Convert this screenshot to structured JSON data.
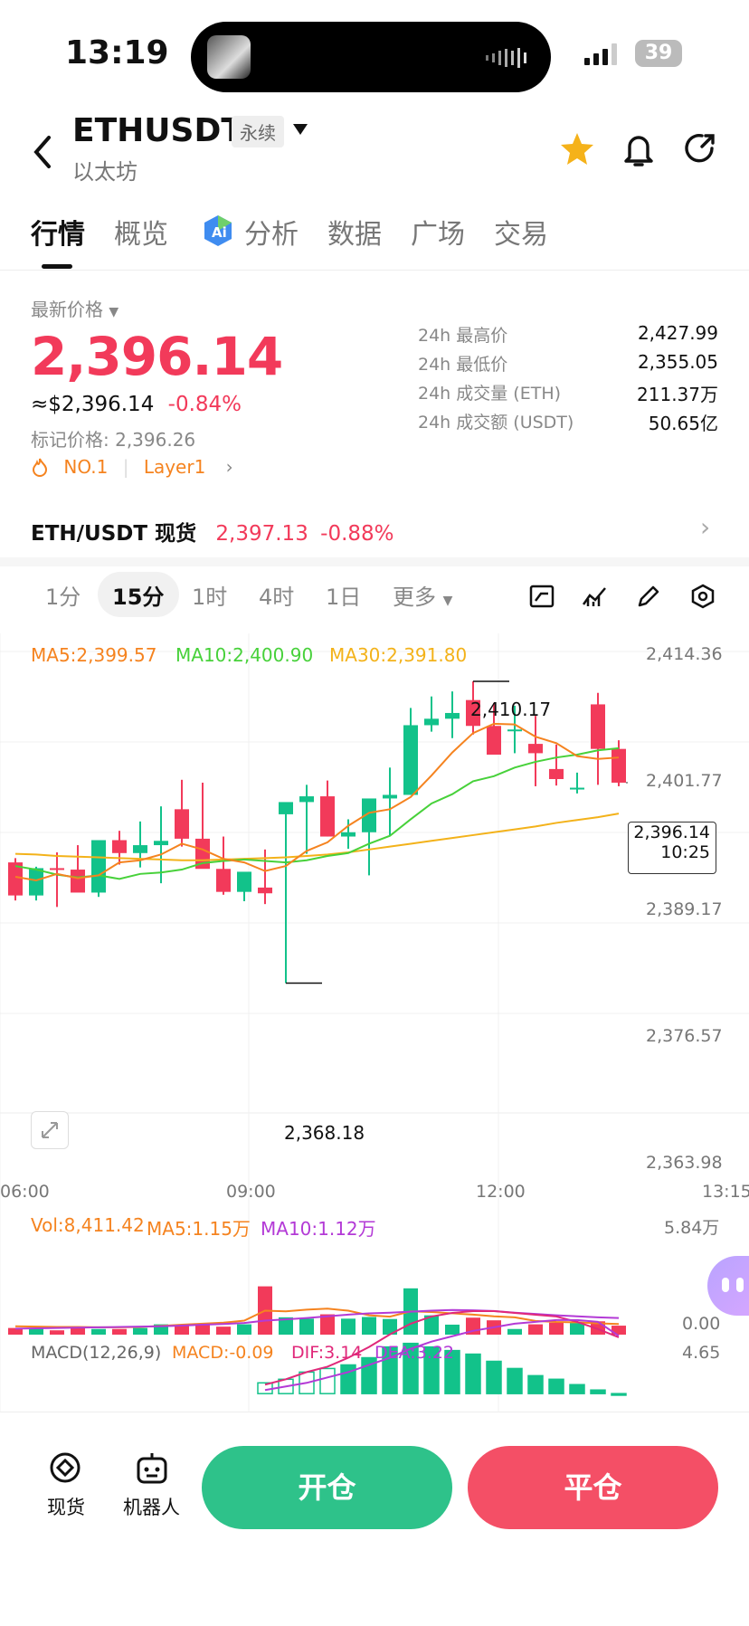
{
  "status": {
    "time": "13:19",
    "battery": "39"
  },
  "header": {
    "symbol": "ETHUSDT",
    "tag": "永续",
    "subtitle": "以太坊"
  },
  "tabs": [
    "行情",
    "概览",
    "分析",
    "数据",
    "广场",
    "交易"
  ],
  "price": {
    "label": "最新价格",
    "last": "2,396.14",
    "usd": "≈$2,396.14",
    "change": "-0.84%",
    "mark": "标记价格: 2,396.26",
    "rank": "NO.1",
    "sector": "Layer1"
  },
  "stats": [
    {
      "label": "24h 最高价",
      "value": "2,427.99"
    },
    {
      "label": "24h 最低价",
      "value": "2,355.05"
    },
    {
      "label": "24h 成交量 (ETH)",
      "value": "211.37万"
    },
    {
      "label": "24h 成交额 (USDT)",
      "value": "50.65亿"
    }
  ],
  "spot": {
    "pair": "ETH/USDT 现货",
    "price": "2,397.13",
    "change": "-0.88%"
  },
  "intervals": [
    "1分",
    "15分",
    "1时",
    "4时",
    "1日",
    "更多"
  ],
  "selected_interval": "15分",
  "ma": {
    "ma5": "MA5:2,399.57",
    "ma10": "MA10:2,400.90",
    "ma30": "MA30:2,391.80"
  },
  "y_ticks": [
    "2,414.36",
    "2,401.77",
    "2,389.17",
    "2,376.57",
    "2,363.98"
  ],
  "x_ticks": [
    "06:00",
    "09:00",
    "12:00",
    "13:15"
  ],
  "chart_annotations": {
    "high": "2,410.17",
    "low": "2,368.18",
    "current_price": "2,396.14",
    "countdown": "10:25"
  },
  "volume": {
    "vol": "Vol:8,411.42",
    "ma5": "MA5:1.15万",
    "ma10": "MA10:1.12万",
    "max": "5.84万",
    "min": "0.00"
  },
  "macd": {
    "label": "MACD(12,26,9)",
    "macd": "MACD:-0.09",
    "dif": "DIF:3.14",
    "dea": "DEA:3.22",
    "max": "4.65"
  },
  "bottom": {
    "spot_label": "现货",
    "bot_label": "机器人",
    "open_label": "开仓",
    "close_label": "平仓"
  },
  "colors": {
    "up": "#12c28a",
    "down": "#f23a5a",
    "ma5": "#f5831f",
    "ma10": "#47d13a",
    "ma30": "#f3b21a",
    "open_btn": "#2ec28a",
    "close_btn": "#f44f66"
  },
  "chart_data": {
    "type": "candlestick",
    "x": [
      "06:00",
      "06:15",
      "06:30",
      "06:45",
      "07:00",
      "07:15",
      "07:30",
      "07:45",
      "08:00",
      "08:15",
      "08:30",
      "08:45",
      "09:00",
      "09:15",
      "09:30",
      "09:45",
      "10:00",
      "10:15",
      "10:30",
      "10:45",
      "11:00",
      "11:15",
      "11:30",
      "11:45",
      "12:00",
      "12:15",
      "12:30",
      "12:45",
      "13:00",
      "13:15"
    ],
    "open": [
      2385.0,
      2380.4,
      2384.2,
      2384.0,
      2380.8,
      2388.1,
      2386.3,
      2387.4,
      2392.4,
      2388.3,
      2384.1,
      2380.9,
      2381.5,
      2391.7,
      2393.4,
      2394.2,
      2388.6,
      2389.2,
      2393.9,
      2394.4,
      2404.1,
      2405.0,
      2407.6,
      2404.0,
      2403.5,
      2401.5,
      2398.0,
      2395.4,
      2407.0,
      2400.8
    ],
    "high": [
      2385.6,
      2384.4,
      2386.4,
      2387.4,
      2385.5,
      2389.4,
      2390.7,
      2392.8,
      2396.5,
      2396.1,
      2388.6,
      2383.3,
      2386.8,
      2392.6,
      2395.8,
      2396.4,
      2391.0,
      2393.2,
      2398.2,
      2406.5,
      2408.1,
      2408.8,
      2410.2,
      2407.2,
      2406.8,
      2405.4,
      2401.4,
      2397.5,
      2408.6,
      2402.0
    ],
    "low": [
      2379.7,
      2379.7,
      2378.8,
      2381.6,
      2380.2,
      2384.7,
      2384.3,
      2382.1,
      2387.2,
      2387.5,
      2380.5,
      2379.6,
      2379.2,
      2368.2,
      2386.2,
      2388.6,
      2386.9,
      2383.2,
      2388.7,
      2394.4,
      2403.2,
      2402.3,
      2402.8,
      2400.1,
      2400.2,
      2395.6,
      2395.7,
      2394.6,
      2395.8,
      2395.6
    ],
    "close": [
      2380.4,
      2384.2,
      2384.0,
      2380.8,
      2388.1,
      2386.3,
      2387.4,
      2388.0,
      2388.3,
      2384.1,
      2380.9,
      2383.7,
      2380.7,
      2393.4,
      2394.2,
      2388.6,
      2389.2,
      2393.9,
      2394.4,
      2404.1,
      2405.0,
      2405.8,
      2404.0,
      2400.0,
      2403.5,
      2400.2,
      2396.6,
      2395.4,
      2400.8,
      2396.1
    ],
    "ma5": [
      2383.0,
      2382.5,
      2383.4,
      2382.8,
      2383.2,
      2385.0,
      2385.3,
      2386.1,
      2387.6,
      2386.8,
      2385.5,
      2385.0,
      2383.8,
      2384.5,
      2386.6,
      2387.8,
      2390.1,
      2391.9,
      2392.4,
      2394.1,
      2397.1,
      2400.3,
      2403.0,
      2404.3,
      2404.2,
      2402.5,
      2401.6,
      2399.8,
      2399.4,
      2399.6
    ],
    "ma10": [
      2384.5,
      2384.0,
      2383.3,
      2382.9,
      2383.2,
      2382.7,
      2383.4,
      2383.6,
      2384.0,
      2384.9,
      2385.2,
      2385.4,
      2385.2,
      2385.0,
      2385.3,
      2385.9,
      2386.3,
      2387.6,
      2388.7,
      2391.0,
      2393.2,
      2394.5,
      2396.3,
      2397.0,
      2398.2,
      2399.0,
      2399.6,
      2400.0,
      2400.6,
      2400.9
    ],
    "ma30": [
      2386.2,
      2386.1,
      2385.9,
      2385.8,
      2385.7,
      2385.6,
      2385.5,
      2385.4,
      2385.3,
      2385.3,
      2385.4,
      2385.5,
      2385.6,
      2385.7,
      2385.9,
      2386.1,
      2386.4,
      2386.8,
      2387.2,
      2387.6,
      2388.0,
      2388.4,
      2388.8,
      2389.2,
      2389.6,
      2390.0,
      2390.5,
      2390.9,
      2391.3,
      2391.8
    ],
    "volume": [
      0.2,
      0.18,
      0.13,
      0.19,
      0.17,
      0.17,
      0.2,
      0.31,
      0.28,
      0.3,
      0.24,
      0.31,
      1.45,
      0.52,
      0.48,
      0.61,
      0.48,
      0.53,
      0.47,
      1.39,
      0.58,
      0.3,
      0.51,
      0.43,
      0.17,
      0.31,
      0.36,
      0.35,
      0.4,
      0.27
    ],
    "volume_ma5": [
      0.25,
      0.24,
      0.23,
      0.23,
      0.22,
      0.22,
      0.23,
      0.26,
      0.3,
      0.33,
      0.36,
      0.42,
      0.72,
      0.7,
      0.75,
      0.78,
      0.72,
      0.58,
      0.54,
      0.7,
      0.68,
      0.64,
      0.6,
      0.55,
      0.52,
      0.41,
      0.38,
      0.37,
      0.34,
      0.32
    ],
    "volume_ma10": [
      0.18,
      0.19,
      0.2,
      0.21,
      0.22,
      0.23,
      0.24,
      0.25,
      0.27,
      0.3,
      0.32,
      0.35,
      0.42,
      0.46,
      0.5,
      0.55,
      0.6,
      0.64,
      0.66,
      0.69,
      0.72,
      0.74,
      0.73,
      0.71,
      0.66,
      0.62,
      0.58,
      0.55,
      0.52,
      0.5
    ],
    "macd_dif": [
      0.5,
      0.8,
      1.2,
      1.5,
      2.0,
      2.6,
      3.3,
      3.9,
      4.3,
      4.5,
      4.6,
      4.6,
      4.5,
      4.4,
      4.3,
      4.0,
      3.6,
      3.14
    ],
    "macd_dea": [
      0.2,
      0.4,
      0.6,
      0.9,
      1.2,
      1.6,
      2.0,
      2.5,
      2.9,
      3.2,
      3.5,
      3.7,
      3.9,
      4.0,
      4.1,
      4.1,
      4.0,
      3.22
    ],
    "macd_hist": [
      0.6,
      0.8,
      1.2,
      1.4,
      1.6,
      2.0,
      2.6,
      2.8,
      2.6,
      2.4,
      2.2,
      1.8,
      1.4,
      1.0,
      0.8,
      0.5,
      0.2,
      -0.09
    ],
    "ylim": [
      2363.98,
      2414.36
    ],
    "volume_ylim": [
      0,
      5.84
    ],
    "volume_unit": "万",
    "macd_ylim": [
      -1,
      4.65
    ]
  }
}
